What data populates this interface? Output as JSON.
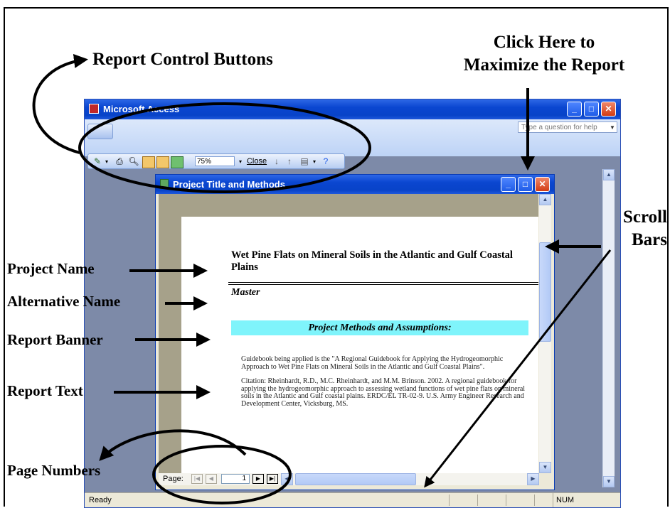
{
  "callouts": {
    "report_control_buttons": "Report Control Buttons",
    "maximize_line1": "Click Here to",
    "maximize_line2": "Maximize the Report",
    "scroll_line1": "Scroll",
    "scroll_line2": "Bars",
    "project_name": "Project Name",
    "alternative_name": "Alternative Name",
    "report_banner": "Report Banner",
    "report_text": "Report Text",
    "page_numbers": "Page Numbers"
  },
  "access_window": {
    "title": "Microsoft Access",
    "help_placeholder": "Type a question for help",
    "toolbar": {
      "zoom": "75%",
      "close_label": "Close"
    },
    "status": {
      "ready": "Ready",
      "num": "NUM"
    }
  },
  "report_window": {
    "title": "Project Title and Methods",
    "project_title": "Wet Pine Flats on Mineral Soils in the Atlantic and Gulf Coastal Plains",
    "alternative": "Master",
    "banner": "Project Methods and Assumptions:",
    "text_paragraph_1": "Guidebook being applied is the \"A Regional Guidebook for Applying the Hydrogeomorphic Approach to Wet Pine Flats on Mineral Soils in the Atlantic and Gulf Coastal Plains\".",
    "text_paragraph_2": "Citation: Rheinhardt, R.D., M.C. Rheinhardt, and M.M. Brinson. 2002. A regional guidebook for applying the hydrogeomorphic approach to assessing wetland functions of wet pine flats on mineral soils in the Atlantic and Gulf coastal plains. ERDC/EL TR-02-9. U.S. Army Engineer Research and Development Center, Vicksburg, MS.",
    "page_label": "Page:",
    "page_number": "1"
  },
  "colors": {
    "title_bar": "#0a46d0",
    "banner": "#7ff4fb",
    "close_button": "#d23c14"
  }
}
